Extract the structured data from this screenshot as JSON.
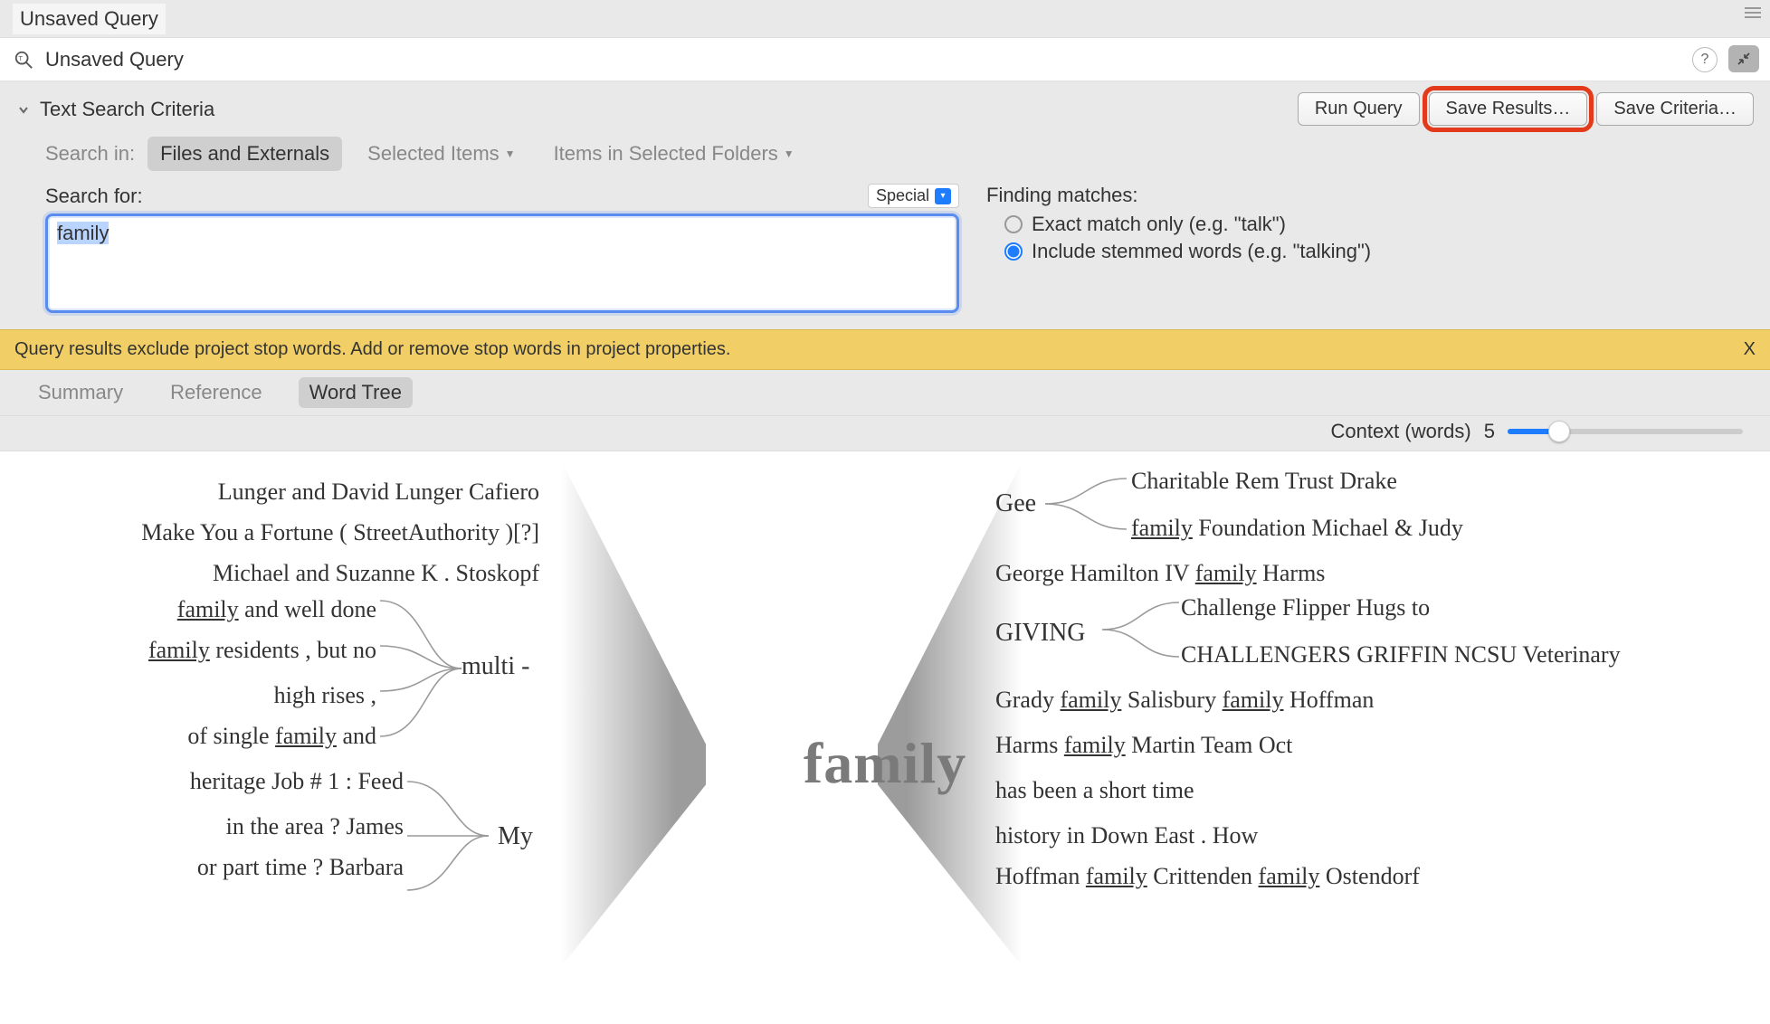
{
  "top": {
    "title": "Unsaved Query",
    "sub_title": "Unsaved Query"
  },
  "help_label": "?",
  "criteria": {
    "title": "Text Search Criteria",
    "run": "Run Query",
    "save_results": "Save Results…",
    "save_criteria": "Save Criteria…"
  },
  "search_in": {
    "label": "Search in:",
    "opts": [
      "Files and Externals",
      "Selected Items",
      "Items in Selected Folders"
    ]
  },
  "search_for": {
    "label": "Search for:",
    "value": "family",
    "special": "Special"
  },
  "finding": {
    "title": "Finding matches:",
    "exact": "Exact match only (e.g. \"talk\")",
    "stemmed": "Include stemmed words (e.g. \"talking\")"
  },
  "warning": {
    "text": "Query results exclude project stop words. Add or remove stop words in project properties.",
    "close": "X"
  },
  "tabs": [
    "Summary",
    "Reference",
    "Word Tree"
  ],
  "context": {
    "label": "Context (words)",
    "value": "5"
  },
  "wordtree": {
    "center": "family",
    "left_primary": [
      "Lunger and David Lunger Cafiero",
      "Make You a Fortune ( StreetAuthority )[?]",
      "Michael and Suzanne K . Stoskopf"
    ],
    "left_multi_group": {
      "label": "multi -",
      "items": [
        "family and well done",
        "family residents , but no",
        "high rises ,",
        "of single family and"
      ]
    },
    "left_my_group": {
      "label": "My",
      "items": [
        "heritage Job # 1 : Feed",
        "in the area ? James",
        "or part time ? Barbara"
      ]
    },
    "right_gee": {
      "label": "Gee",
      "items": [
        "Charitable Rem Trust Drake",
        "family Foundation Michael & Judy"
      ]
    },
    "right_lines": [
      "George Hamilton IV family Harms"
    ],
    "right_giving": {
      "label": "GIVING",
      "items": [
        "Challenge Flipper Hugs to",
        "CHALLENGERS GRIFFIN NCSU Veterinary"
      ]
    },
    "right_more": [
      "Grady family Salisbury family Hoffman",
      "Harms family Martin Team Oct",
      "has been a short time",
      "history in Down East . How",
      "Hoffman family Crittenden family Ostendorf"
    ]
  }
}
